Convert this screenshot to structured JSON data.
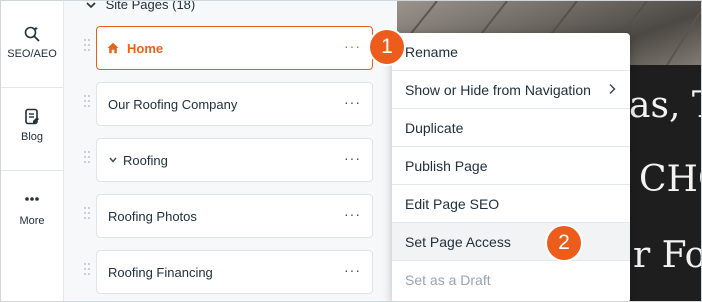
{
  "rail": {
    "items": [
      {
        "label": "SEO/AEO",
        "icon": "seo-search-icon"
      },
      {
        "label": "Blog",
        "icon": "blog-icon"
      },
      {
        "label": "More",
        "icon": "more-dots-icon"
      }
    ]
  },
  "pages": {
    "section_title": "Site Pages (18)",
    "items": [
      {
        "name": "Home",
        "active": true,
        "icon": "home-icon",
        "menu": "···"
      },
      {
        "name": "Our Roofing Company",
        "menu": "···"
      },
      {
        "name": "Roofing",
        "expandable": true,
        "menu": "···"
      },
      {
        "name": "Roofing Photos",
        "menu": "···"
      },
      {
        "name": "Roofing Financing",
        "menu": "···"
      }
    ]
  },
  "context_menu": {
    "items": [
      {
        "label": "Rename"
      },
      {
        "label": "Show or Hide from Navigation",
        "submenu": true
      },
      {
        "label": "Duplicate"
      },
      {
        "label": "Publish Page"
      },
      {
        "label": "Edit Page SEO"
      },
      {
        "label": "Set Page Access",
        "hover": true
      },
      {
        "label": "Set as a Draft",
        "disabled": true
      }
    ]
  },
  "preview": {
    "lines": [
      "as, T",
      "CHC",
      "r Fo"
    ]
  },
  "badges": [
    "1",
    "2"
  ],
  "colors": {
    "accent": "#e8631a",
    "badge": "#ec5d1c",
    "dark_bg": "#1e1e1f"
  }
}
